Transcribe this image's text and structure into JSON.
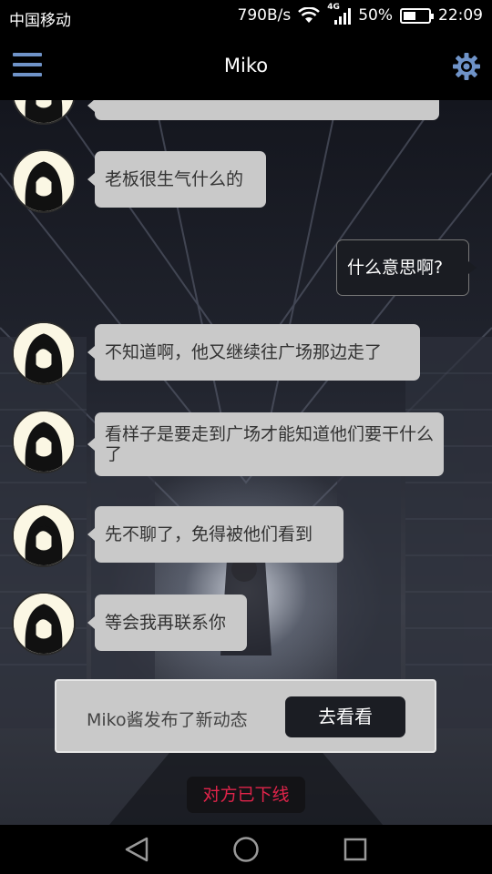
{
  "status_bar": {
    "carrier": "中国移动",
    "speed": "790B/s",
    "network": "4G",
    "battery": "50%",
    "battery_level": 0.5,
    "time": "22:09"
  },
  "header": {
    "title": "Miko",
    "menu_icon": "hamburger-menu-icon",
    "settings_icon": "gear-icon"
  },
  "messages": [
    {
      "from": "miko",
      "text": ""
    },
    {
      "from": "miko",
      "text": "老板很生气什么的"
    },
    {
      "from": "me",
      "text": "什么意思啊?"
    },
    {
      "from": "miko",
      "text": "不知道啊，他又继续往广场那边走了"
    },
    {
      "from": "miko",
      "text": "看样子是要走到广场才能知道他们要干什么了"
    },
    {
      "from": "miko",
      "text": "先不聊了，免得被他们看到"
    },
    {
      "from": "miko",
      "text": "等会我再联系你"
    }
  ],
  "notice": {
    "text": "Miko酱发布了新动态",
    "button_label": "去看看"
  },
  "offline_status": "对方已下线",
  "colors": {
    "accent_icon": "#6f93c8",
    "bubble_other": "#c9c9c9",
    "bubble_mine": "#1a1c22",
    "offline_text": "#e0244a"
  },
  "nav_bar": {
    "back_icon": "back-triangle-icon",
    "home_icon": "home-circle-icon",
    "recents_icon": "recents-square-icon"
  }
}
